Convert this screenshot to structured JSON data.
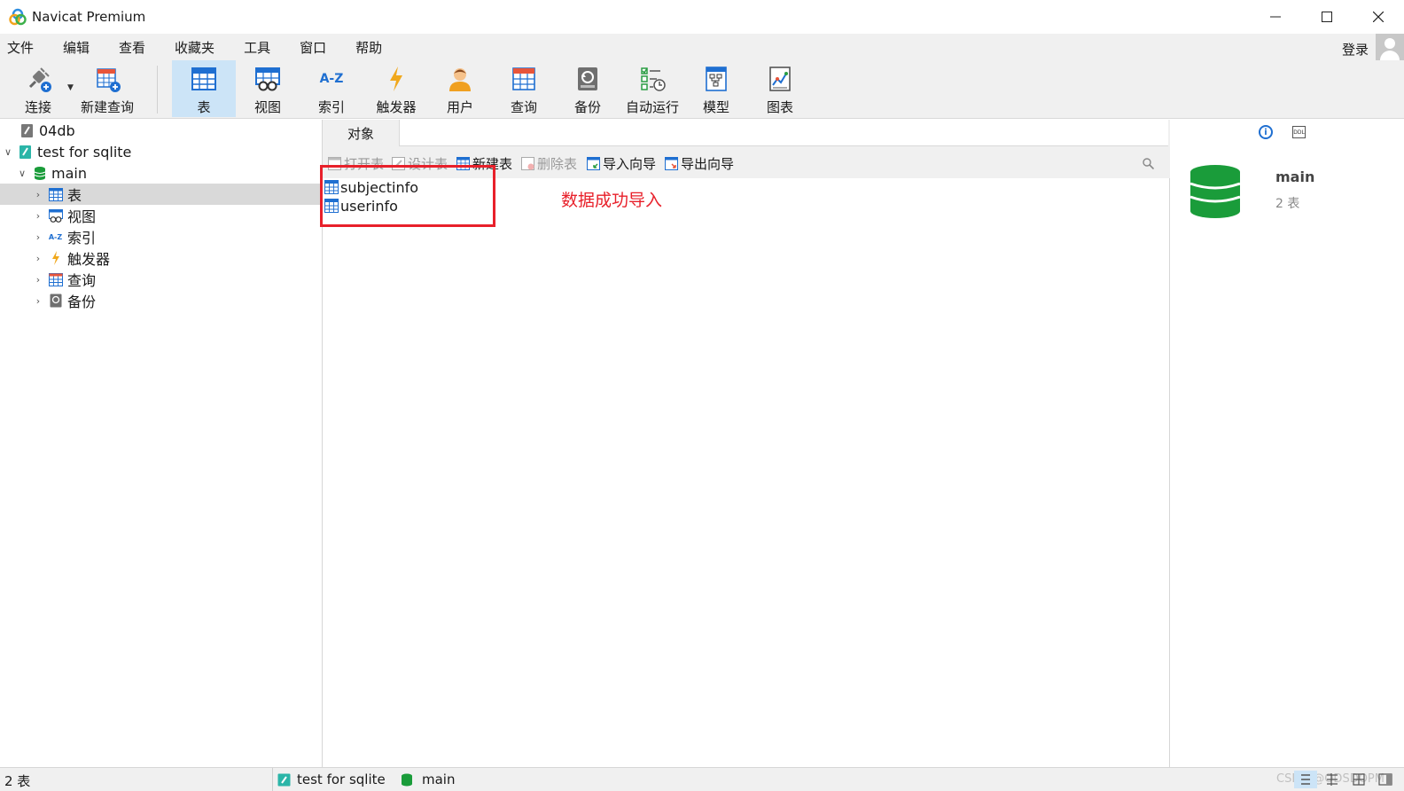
{
  "window": {
    "title": "Navicat Premium",
    "controls": {
      "minimize": "—",
      "maximize": "☐",
      "close": "✕"
    }
  },
  "menu": {
    "items": [
      "文件",
      "编辑",
      "查看",
      "收藏夹",
      "工具",
      "窗口",
      "帮助"
    ],
    "login": "登录"
  },
  "toolbar": {
    "connect": "连接",
    "new_query": "新建查询",
    "table": "表",
    "view": "视图",
    "index": "索引",
    "index_icon_text": "A-Z",
    "trigger": "触发器",
    "user": "用户",
    "query": "查询",
    "backup": "备份",
    "automation": "自动运行",
    "model": "模型",
    "chart": "图表",
    "active": "table"
  },
  "nav": {
    "items": [
      {
        "label": "04db",
        "icon": "sqlite-file-icon",
        "level": 0
      },
      {
        "label": "test for sqlite",
        "icon": "sqlite-connection-icon",
        "level": 0,
        "expanded": true
      },
      {
        "label": "main",
        "icon": "database-icon",
        "level": 1,
        "expanded": true
      },
      {
        "label": "表",
        "icon": "table-icon",
        "level": 2,
        "selected": true
      },
      {
        "label": "视图",
        "icon": "view-icon",
        "level": 2
      },
      {
        "label": "索引",
        "icon": "index-icon",
        "level": 2
      },
      {
        "label": "触发器",
        "icon": "trigger-icon",
        "level": 2
      },
      {
        "label": "查询",
        "icon": "query-icon",
        "level": 2
      },
      {
        "label": "备份",
        "icon": "backup-icon",
        "level": 2
      }
    ],
    "index_icon_text": "A-Z"
  },
  "objects": {
    "tab": "对象",
    "toolbar": {
      "open_table": "打开表",
      "design_table": "设计表",
      "new_table": "新建表",
      "delete_table": "删除表",
      "import_wizard": "导入向导",
      "export_wizard": "导出向导"
    },
    "list": [
      "subjectinfo",
      "userinfo"
    ],
    "annotation": "数据成功导入",
    "annotation_color": "#e8202a"
  },
  "detail": {
    "title": "main",
    "subtitle": "2 表",
    "ddl_label": "DDL"
  },
  "status": {
    "count": "2 表",
    "connection": "test for sqlite",
    "database": "main",
    "watermark": "CSDN @ODSDOPM"
  },
  "colors": {
    "accent": "#1f6fd1",
    "db_green": "#1a9c3a",
    "selected_tool": "#cce4f7"
  }
}
